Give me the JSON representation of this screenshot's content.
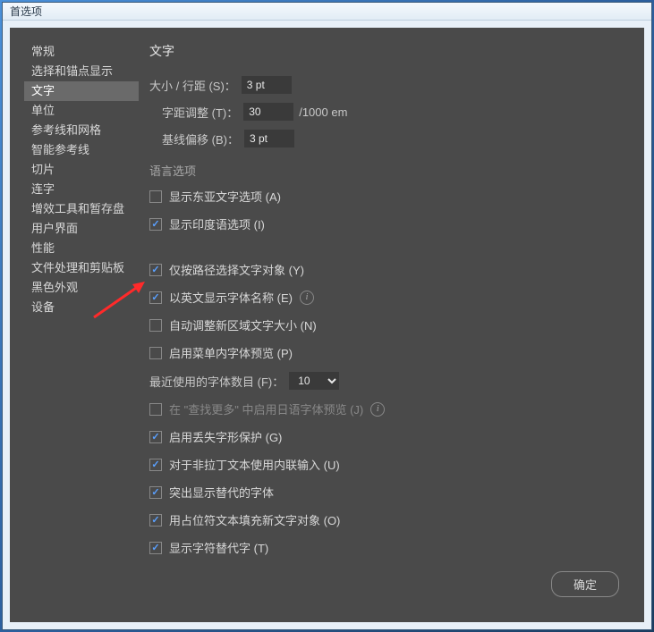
{
  "window": {
    "title": "首选项"
  },
  "sidebar": {
    "items": [
      {
        "label": "常规",
        "active": false
      },
      {
        "label": "选择和锚点显示",
        "active": false
      },
      {
        "label": "文字",
        "active": true
      },
      {
        "label": "单位",
        "active": false
      },
      {
        "label": "参考线和网格",
        "active": false
      },
      {
        "label": "智能参考线",
        "active": false
      },
      {
        "label": "切片",
        "active": false
      },
      {
        "label": "连字",
        "active": false
      },
      {
        "label": "增效工具和暂存盘",
        "active": false
      },
      {
        "label": "用户界面",
        "active": false
      },
      {
        "label": "性能",
        "active": false
      },
      {
        "label": "文件处理和剪贴板",
        "active": false
      },
      {
        "label": "黑色外观",
        "active": false
      },
      {
        "label": "设备",
        "active": false
      }
    ]
  },
  "content": {
    "title": "文字",
    "fields": {
      "size_leading": {
        "label": "大小 / 行距 (S)：",
        "value": "3 pt"
      },
      "tracking": {
        "label": "字距调整 (T)：",
        "value": "30",
        "suffix": "/1000 em"
      },
      "baseline": {
        "label": "基线偏移 (B)：",
        "value": "3 pt"
      }
    },
    "lang_section": "语言选项",
    "checkboxes": {
      "east_asian": {
        "label": "显示东亚文字选项 (A)",
        "checked": false
      },
      "indic": {
        "label": "显示印度语选项 (I)",
        "checked": true
      },
      "path_select": {
        "label": "仅按路径选择文字对象 (Y)",
        "checked": true
      },
      "english_font": {
        "label": "以英文显示字体名称 (E)",
        "checked": true,
        "info": true
      },
      "auto_size": {
        "label": "自动调整新区域文字大小 (N)",
        "checked": false
      },
      "menu_preview": {
        "label": "启用菜单内字体预览 (P)",
        "checked": false
      },
      "recent_fonts": {
        "label": "最近使用的字体数目 (F)：",
        "value": "10"
      },
      "jp_preview": {
        "label": "在 \"查找更多\" 中启用日语字体预览 (J)",
        "checked": false,
        "info": true
      },
      "missing_glyph": {
        "label": "启用丢失字形保护 (G)",
        "checked": true
      },
      "inline_input": {
        "label": "对于非拉丁文本使用内联输入 (U)",
        "checked": true
      },
      "highlight_alt": {
        "label": "突出显示替代的字体",
        "checked": true
      },
      "placeholder_fill": {
        "label": "用占位符文本填充新文字对象 (O)",
        "checked": true
      },
      "show_alt_glyph": {
        "label": "显示字符替代字 (T)",
        "checked": true
      }
    }
  },
  "buttons": {
    "ok": "确定"
  }
}
